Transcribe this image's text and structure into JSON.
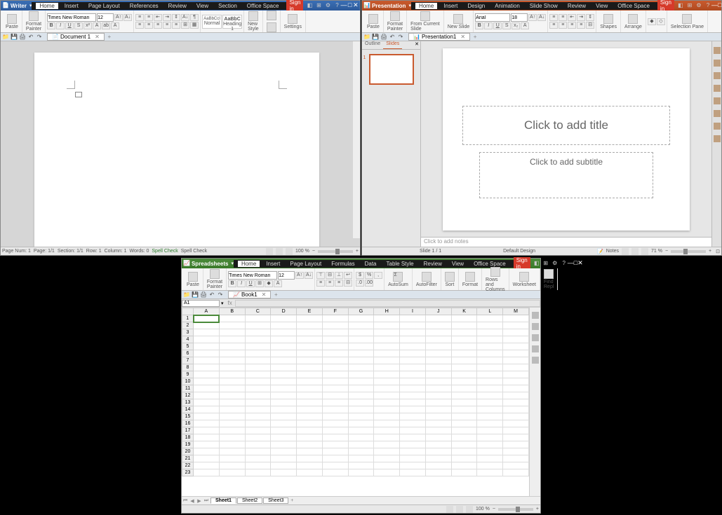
{
  "writer": {
    "app_name": "Writer",
    "menus": [
      "Home",
      "Insert",
      "Page Layout",
      "References",
      "Review",
      "View",
      "Section",
      "Office Space"
    ],
    "signin": "Sign in",
    "font": "Times New Roman",
    "font_size": "12",
    "styles": {
      "normal": "Normal",
      "heading1": "Heading 1"
    },
    "ribbon": {
      "paste": "Paste",
      "format_painter": "Format\nPainter",
      "new_style": "New\nStyle",
      "settings": "Settings"
    },
    "style_preview1": "AaBbCcI",
    "style_preview2": "AaBbC",
    "doc_tab": "Document 1",
    "status": {
      "page_num": "Page Num: 1",
      "page": "Page: 1/1",
      "section": "Section: 1/1",
      "row": "Row: 1",
      "column": "Column: 1",
      "words": "Words: 0",
      "spell": "Spell Check",
      "zoom": "100 %"
    }
  },
  "presentation": {
    "app_name": "Presentation",
    "menus": [
      "Home",
      "Insert",
      "Design",
      "Animation",
      "Slide Show",
      "Review",
      "View",
      "Office Space"
    ],
    "signin": "Sign in",
    "font": "Arial",
    "font_size": "18",
    "ribbon": {
      "paste": "Paste",
      "format_painter": "Format\nPainter",
      "from_current": "From Current\nSlide",
      "new_slide": "New Slide",
      "shapes": "Shapes",
      "arrange": "Arrange",
      "selection_pane": "Selection Pane"
    },
    "doc_tab": "Presentation1",
    "sidebar_tabs": {
      "outline": "Outline",
      "slides": "Slides"
    },
    "thumb_num": "1",
    "title_placeholder": "Click to add title",
    "subtitle_placeholder": "Click to add subtitle",
    "notes_placeholder": "Click to add notes",
    "status": {
      "slide": "Slide 1 / 1",
      "design": "Default Design",
      "notes": "Notes",
      "zoom": "71 %"
    }
  },
  "spreadsheets": {
    "app_name": "Spreadsheets",
    "menus": [
      "Home",
      "Insert",
      "Page Layout",
      "Formulas",
      "Data",
      "Table Style",
      "Review",
      "View",
      "Office Space"
    ],
    "signin": "Sign in",
    "font": "Times New Roman",
    "font_size": "12",
    "ribbon": {
      "paste": "Paste",
      "format_painter": "Format\nPainter",
      "autosum": "AutoSum",
      "autofilter": "AutoFilter",
      "sort": "Sort",
      "format": "Format",
      "rows_cols": "Rows and\nColumns",
      "worksheet": "Worksheet",
      "find_replace": "Find\nRepl"
    },
    "doc_tab": "Book1",
    "namebox": "A1",
    "fx": "fx",
    "columns": [
      "A",
      "B",
      "C",
      "D",
      "E",
      "F",
      "G",
      "H",
      "I",
      "J",
      "K",
      "L",
      "M"
    ],
    "row_count": 23,
    "sheets": [
      "Sheet1",
      "Sheet2",
      "Sheet3"
    ],
    "status": {
      "zoom": "100 %"
    }
  }
}
